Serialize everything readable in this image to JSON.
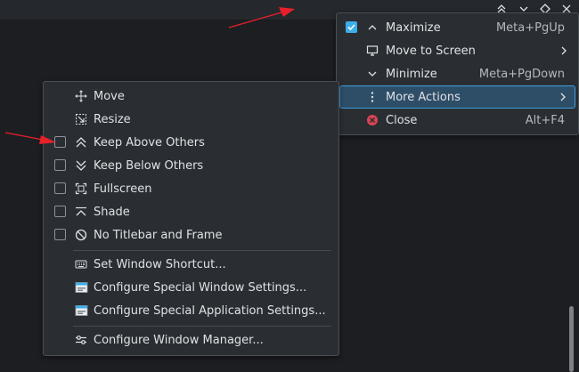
{
  "colors": {
    "accent": "#3daee9",
    "highlight_bg": "#2e4e68",
    "close_red": "#da4453",
    "annotation_arrow": "#e8202a"
  },
  "titlebar": {
    "buttons": [
      "keep-above-icon",
      "minimize-icon",
      "maximize-icon",
      "close-icon"
    ]
  },
  "main_menu": {
    "items": [
      {
        "label": "Maximize",
        "shortcut": "Meta+PgUp",
        "checked": true,
        "icon": "chevron-up-icon"
      },
      {
        "label": "Move to Screen",
        "shortcut": "",
        "icon": "monitor-icon",
        "submenu": true
      },
      {
        "label": "Minimize",
        "shortcut": "Meta+PgDown",
        "icon": "chevron-down-icon"
      },
      {
        "label": "More Actions",
        "shortcut": "",
        "icon": "more-vertical-icon",
        "submenu": true,
        "highlighted": true
      },
      {
        "label": "Close",
        "shortcut": "Alt+F4",
        "icon": "close-circle-icon"
      }
    ]
  },
  "more_actions_menu": {
    "items": [
      {
        "label": "Move",
        "icon": "move-icon"
      },
      {
        "label": "Resize",
        "icon": "resize-icon"
      },
      {
        "label": "Keep Above Others",
        "icon": "double-chevron-up-icon",
        "checked": false
      },
      {
        "label": "Keep Below Others",
        "icon": "double-chevron-down-icon",
        "checked": false
      },
      {
        "label": "Fullscreen",
        "icon": "fullscreen-icon",
        "checked": false
      },
      {
        "label": "Shade",
        "icon": "shade-icon",
        "checked": false
      },
      {
        "label": "No Titlebar and Frame",
        "icon": "no-frame-icon",
        "checked": false
      },
      {
        "label": "Set Window Shortcut...",
        "icon": "keyboard-icon"
      },
      {
        "label": "Configure Special Window Settings...",
        "icon": "window-settings-icon"
      },
      {
        "label": "Configure Special Application Settings...",
        "icon": "app-settings-icon"
      },
      {
        "label": "Configure Window Manager...",
        "icon": "configure-icon"
      }
    ]
  }
}
